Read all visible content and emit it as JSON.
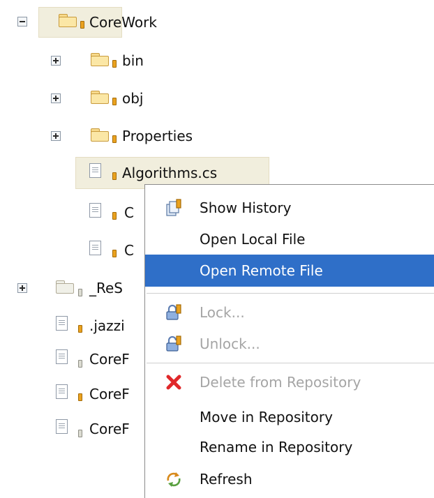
{
  "tree": {
    "root": {
      "label": "CoreWork"
    },
    "children": [
      {
        "label": "bin"
      },
      {
        "label": "obj"
      },
      {
        "label": "Properties"
      },
      {
        "label": "Algorithms.cs"
      },
      {
        "label": "C"
      },
      {
        "label": "C"
      }
    ],
    "siblings": [
      {
        "label": "_ReS"
      },
      {
        "label": ".jazzi"
      },
      {
        "label": "CoreF"
      },
      {
        "label": "CoreF"
      },
      {
        "label": "CoreF"
      }
    ]
  },
  "context_menu": {
    "items": [
      {
        "label": "Show History",
        "icon": "history-icon",
        "state": "normal"
      },
      {
        "label": "Open Local File",
        "icon": "",
        "state": "normal"
      },
      {
        "label": "Open Remote File",
        "icon": "",
        "state": "highlighted"
      },
      {
        "label": "Lock...",
        "icon": "lock-icon",
        "state": "disabled"
      },
      {
        "label": "Unlock...",
        "icon": "unlock-icon",
        "state": "disabled"
      },
      {
        "label": "Delete from Repository",
        "icon": "delete-icon",
        "state": "disabled"
      },
      {
        "label": "Move in Repository",
        "icon": "",
        "state": "normal"
      },
      {
        "label": "Rename in Repository",
        "icon": "",
        "state": "normal"
      },
      {
        "label": "Refresh",
        "icon": "refresh-icon",
        "state": "normal"
      }
    ]
  },
  "colors": {
    "highlight": "#2f6fc8",
    "selection": "#f1eedd",
    "folder": "#fbe7a6",
    "badge": "#eaa21f",
    "delete": "#e0282a"
  }
}
